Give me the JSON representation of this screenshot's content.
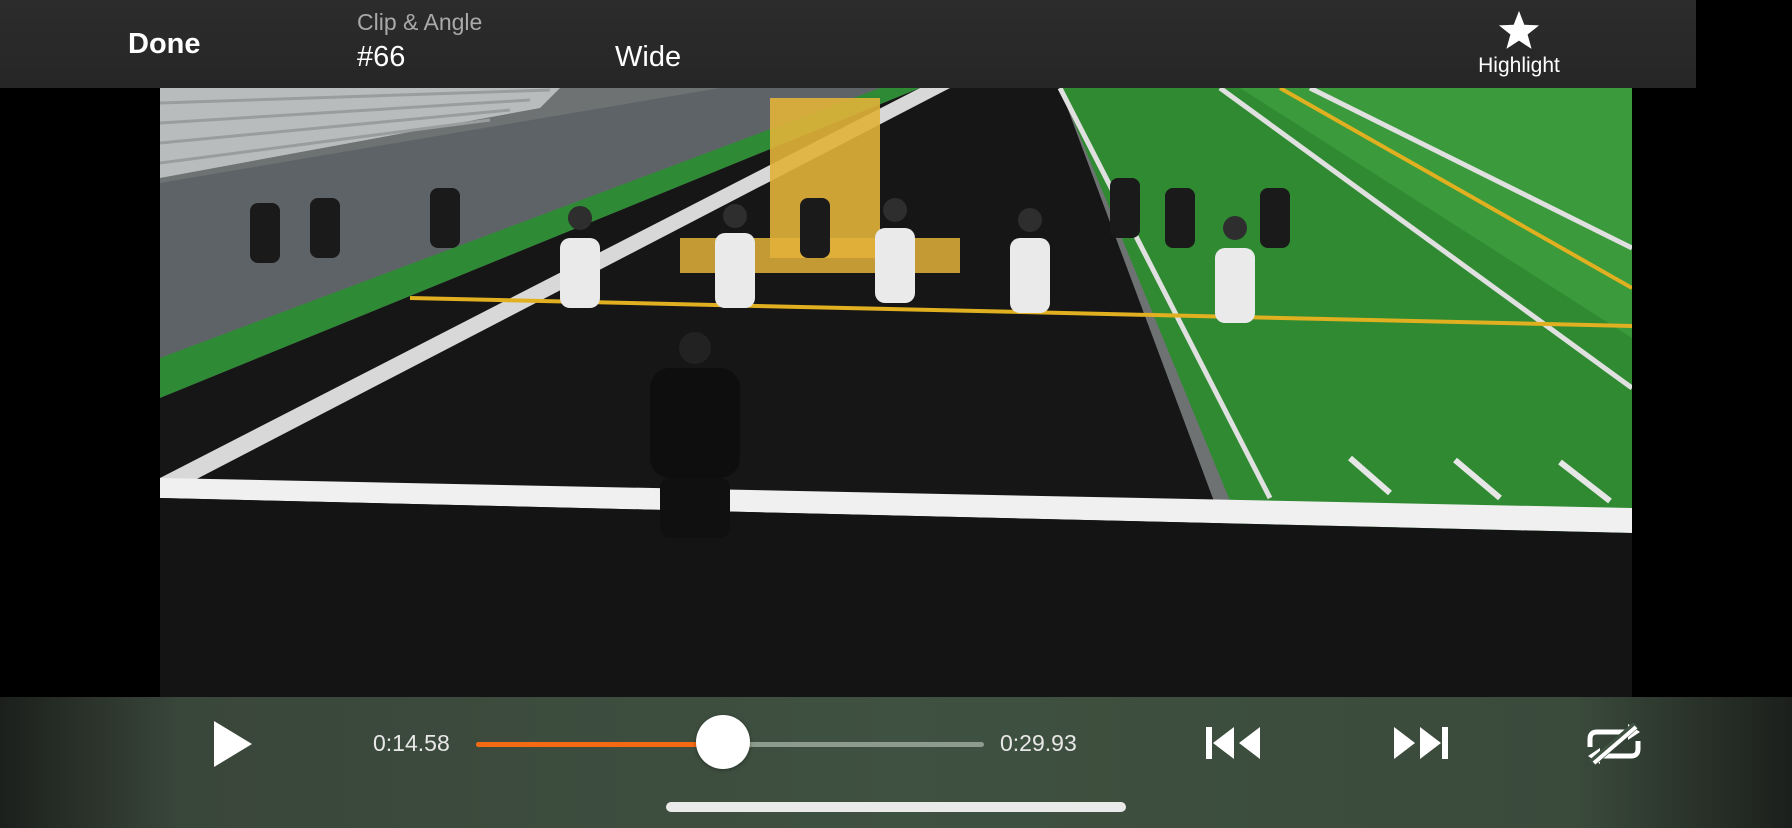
{
  "header": {
    "done_label": "Done",
    "clip_angle_label": "Clip & Angle",
    "clip_number": "#66",
    "angle_value": "Wide",
    "highlight_label": "Highlight",
    "highlight_icon": "star-icon"
  },
  "video": {
    "description_icon": "video-frame"
  },
  "player": {
    "current_time": "0:14.58",
    "total_time": "0:29.93",
    "progress_fraction": 0.487,
    "play_icon": "play-icon",
    "skip_back_icon": "skip-back-icon",
    "skip_forward_icon": "skip-forward-icon",
    "loop_off_icon": "loop-off-icon",
    "accent_color": "#f36a12"
  }
}
